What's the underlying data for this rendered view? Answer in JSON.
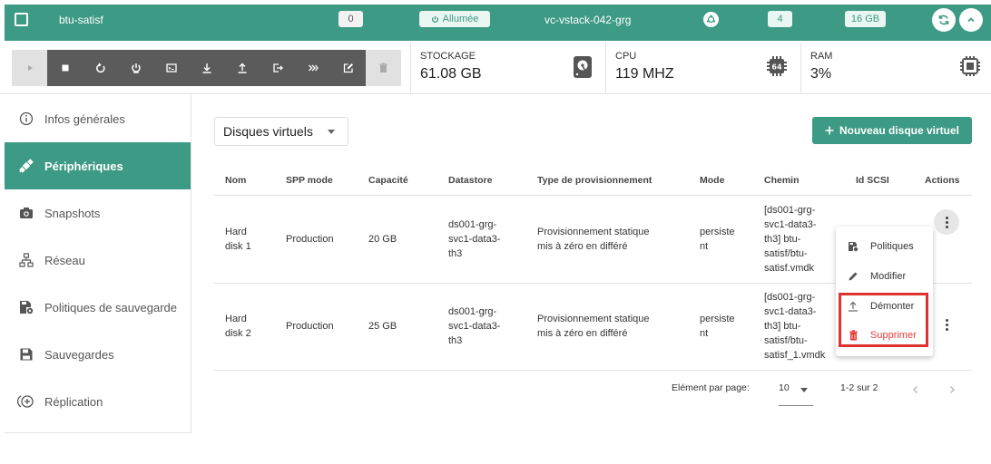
{
  "topbar": {
    "vm_name": "btu-satisf",
    "count_badge": "0",
    "status": "Allumée",
    "vcenter": "vc-vstack-042-grg",
    "cpu_count": "4",
    "ram_size": "16 GB",
    "accent_color": "#3d9a84"
  },
  "toolbar": {
    "buttons": [
      "play-icon",
      "stop-icon",
      "restart-icon",
      "power-icon",
      "console-icon",
      "download-icon",
      "upload-icon",
      "export-icon",
      "fast-forward-icon",
      "edit-icon",
      "trash-icon"
    ]
  },
  "stats": {
    "storage": {
      "label": "STOCKAGE",
      "value": "61.08 GB"
    },
    "cpu": {
      "label": "CPU",
      "value": "119 MHZ"
    },
    "ram": {
      "label": "RAM",
      "value": "3%"
    }
  },
  "sidebar": {
    "items": [
      {
        "label": "Infos générales",
        "icon": "info-icon"
      },
      {
        "label": "Périphériques",
        "icon": "satellite-icon",
        "active": true
      },
      {
        "label": "Snapshots",
        "icon": "camera-icon"
      },
      {
        "label": "Réseau",
        "icon": "network-icon"
      },
      {
        "label": "Politiques de sauvegarde",
        "icon": "backup-policy-icon"
      },
      {
        "label": "Sauvegardes",
        "icon": "save-icon"
      },
      {
        "label": "Réplication",
        "icon": "replication-icon"
      }
    ]
  },
  "main": {
    "dropdown_value": "Disques virtuels",
    "new_button": "Nouveau disque virtuel",
    "columns": [
      "Nom",
      "SPP mode",
      "Capacité",
      "Datastore",
      "Type de provisionnement",
      "Mode",
      "Chemin",
      "Id SCSI",
      "Actions"
    ],
    "rows": [
      {
        "name": [
          "Hard",
          "disk 1"
        ],
        "spp_mode": "Production",
        "capacity": "20 GB",
        "datastore": [
          "ds001-grg-",
          "svc1-data3-",
          "th3"
        ],
        "provisioning": [
          "Provisionnement statique",
          "mis à zéro en différé"
        ],
        "mode": [
          "persiste",
          "nt"
        ],
        "path": [
          "[ds001-grg-",
          "svc1-data3-",
          "th3] btu-",
          "satisf/btu-",
          "satisf.vmdk"
        ],
        "scsi_id": ""
      },
      {
        "name": [
          "Hard",
          "disk 2"
        ],
        "spp_mode": "Production",
        "capacity": "25 GB",
        "datastore": [
          "ds001-grg-",
          "svc1-data3-",
          "th3"
        ],
        "provisioning": [
          "Provisionnement statique",
          "mis à zéro en différé"
        ],
        "mode": [
          "persiste",
          "nt"
        ],
        "path": [
          "[ds001-grg-",
          "svc1-data3-",
          "th3] btu-",
          "satisf/btu-",
          "satisf_1.vmdk"
        ],
        "scsi_id": ""
      }
    ],
    "pagination": {
      "per_page_label": "Elément par page:",
      "per_page_value": "10",
      "range": "1-2 sur 2"
    }
  },
  "menu": {
    "items": [
      {
        "label": "Politiques",
        "icon": "policy-icon"
      },
      {
        "label": "Modifier",
        "icon": "pencil-icon"
      },
      {
        "label": "Démonter",
        "icon": "unmount-icon"
      },
      {
        "label": "Supprimer",
        "icon": "delete-icon",
        "danger": true
      }
    ],
    "danger_color": "#e53935",
    "highlight_color": "#e03131"
  }
}
